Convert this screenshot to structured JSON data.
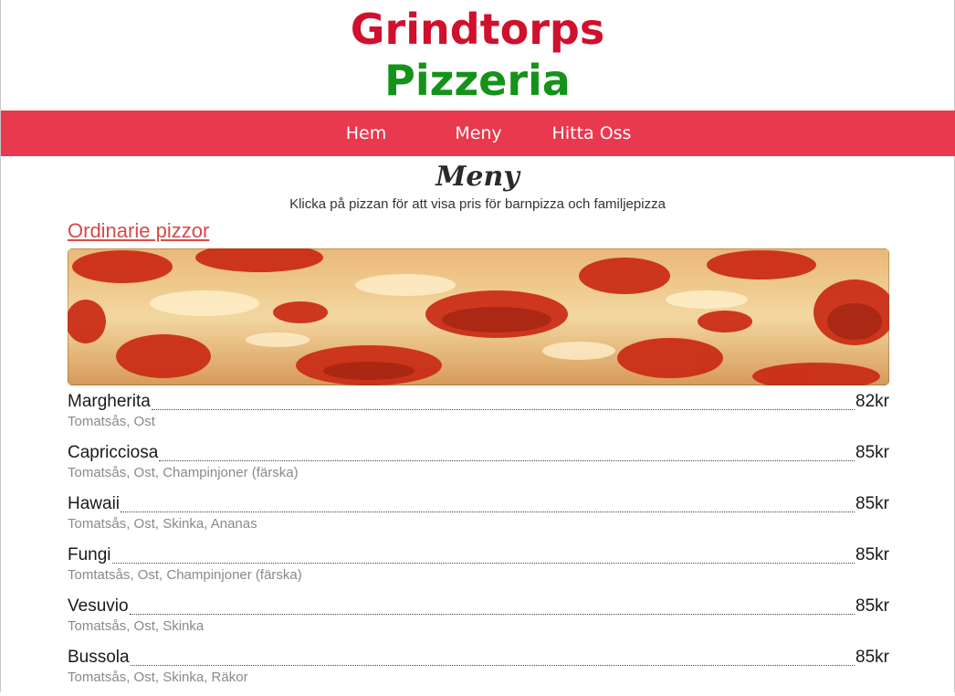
{
  "header": {
    "logo_line1": "Grindtorps",
    "logo_line2": "Pizzeria"
  },
  "nav": {
    "items": [
      {
        "label": "Hem"
      },
      {
        "label": "Meny"
      },
      {
        "label": "Hitta Oss"
      }
    ]
  },
  "main": {
    "title": "Meny",
    "subtitle": "Klicka på pizzan för att visa pris för barnpizza och familjepizza",
    "section": {
      "title": "Ordinarie pizzor",
      "items": [
        {
          "name": "Margherita",
          "price": "82kr",
          "desc": "Tomatsås, Ost"
        },
        {
          "name": "Capricciosa",
          "price": "85kr",
          "desc": "Tomatsås, Ost, Champinjoner (färska)"
        },
        {
          "name": "Hawaii",
          "price": "85kr",
          "desc": "Tomatsås, Ost, Skinka, Ananas"
        },
        {
          "name": "Fungi",
          "price": "85kr",
          "desc": "Tomtatsås, Ost, Champinjoner (färska)"
        },
        {
          "name": "Vesuvio",
          "price": "85kr",
          "desc": "Tomatsås, Ost, Skinka"
        },
        {
          "name": "Bussola",
          "price": "85kr",
          "desc": "Tomatsås, Ost, Skinka, Räkor"
        }
      ]
    }
  },
  "colors": {
    "brand_red": "#d0102c",
    "brand_green": "#15921a",
    "nav_bg": "#e8394f",
    "link": "#d64a4a"
  }
}
